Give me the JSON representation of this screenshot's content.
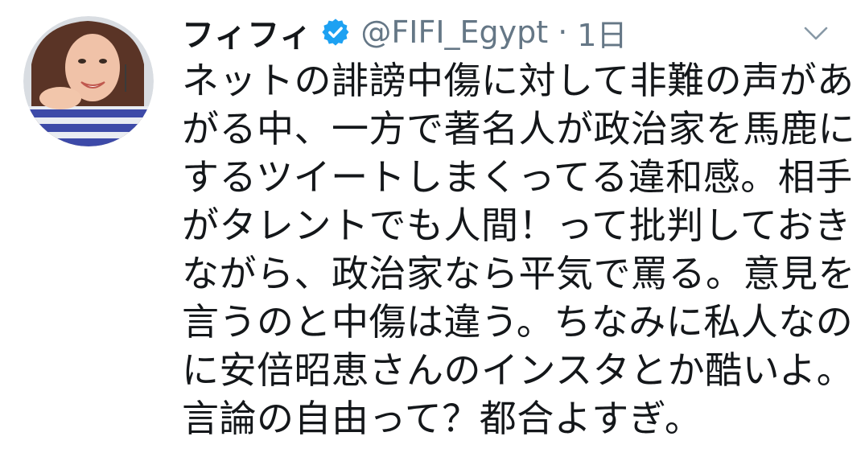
{
  "tweet": {
    "display_name": "フィフィ",
    "handle": "@FIFI_Egypt",
    "separator": "·",
    "timestamp": "1日",
    "verified_icon": "verified-badge-icon",
    "menu_icon": "chevron-down-icon",
    "text_lines": [
      "ネットの誹謗中傷に対して非難の声があ",
      "がる中、一方で著名人が政治家を馬鹿に",
      "するツイートしまくってる違和感。相手",
      "がタレントでも人間！って批判しておき",
      "ながら、政治家なら平気で罵る。意見を",
      "言うのと中傷は違う。ちなみに私人なの",
      "に安倍昭恵さんのインスタとか酷いよ。",
      "言論の自由って？都合よすぎ。"
    ]
  },
  "colors": {
    "primary_text": "#14171a",
    "secondary_text": "#657786",
    "verified_blue": "#1da1f2",
    "chevron": "#8899a6"
  }
}
